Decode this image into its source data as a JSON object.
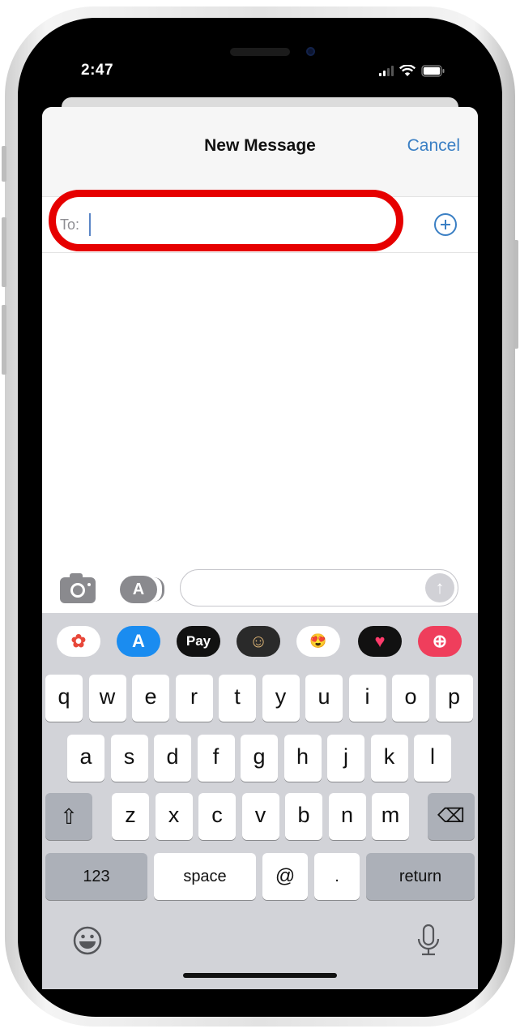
{
  "status_bar": {
    "time": "2:47",
    "icons": [
      "cellular-signal-icon",
      "wifi-icon",
      "battery-icon"
    ]
  },
  "nav": {
    "title": "New Message",
    "cancel_label": "Cancel"
  },
  "recipient": {
    "label": "To:",
    "value": "",
    "add_contact_icon": "plus-circle-icon"
  },
  "compose": {
    "camera_icon": "camera-icon",
    "apps_icon": "app-store-icon",
    "apps_glyph": "A",
    "message_value": "",
    "send_glyph": "↑"
  },
  "app_strip": [
    {
      "name": "Photos",
      "icon": "photos-icon",
      "text": "✿",
      "bg": "#ffffff",
      "fg": "#e8483a"
    },
    {
      "name": "App Store",
      "icon": "app-store-icon",
      "text": "A",
      "bg": "#1a8cf0",
      "fg": "#ffffff"
    },
    {
      "name": "Apple Pay",
      "icon": "apple-pay-icon",
      "text": "Pay",
      "bg": "#111111",
      "fg": "#ffffff"
    },
    {
      "name": "Memoji",
      "icon": "memoji-icon",
      "text": "☺",
      "bg": "#2a2a2a",
      "fg": "#e1b777"
    },
    {
      "name": "Memoji Stickers",
      "icon": "memoji-stickers-icon",
      "text": "😍",
      "bg": "#ffffff",
      "fg": "#d9432f"
    },
    {
      "name": "Digital Touch",
      "icon": "digital-touch-icon",
      "text": "♥",
      "bg": "#111111",
      "fg": "#ff3b6b"
    },
    {
      "name": "Images",
      "icon": "image-search-icon",
      "text": "⊕",
      "bg": "#ef3e5c",
      "fg": "#ffffff"
    }
  ],
  "keyboard": {
    "row1": [
      "q",
      "w",
      "e",
      "r",
      "t",
      "y",
      "u",
      "i",
      "o",
      "p"
    ],
    "row2": [
      "a",
      "s",
      "d",
      "f",
      "g",
      "h",
      "j",
      "k",
      "l"
    ],
    "row3": [
      "z",
      "x",
      "c",
      "v",
      "b",
      "n",
      "m"
    ],
    "shift_glyph": "⇧",
    "delete_glyph": "⌫",
    "numbers_label": "123",
    "space_label": "space",
    "at_label": "@",
    "dot_label": ".",
    "return_label": "return",
    "emoji_icon": "emoji-icon",
    "mic_icon": "microphone-icon"
  },
  "colors": {
    "accent": "#3a7fc4",
    "highlight": "#e60000"
  }
}
